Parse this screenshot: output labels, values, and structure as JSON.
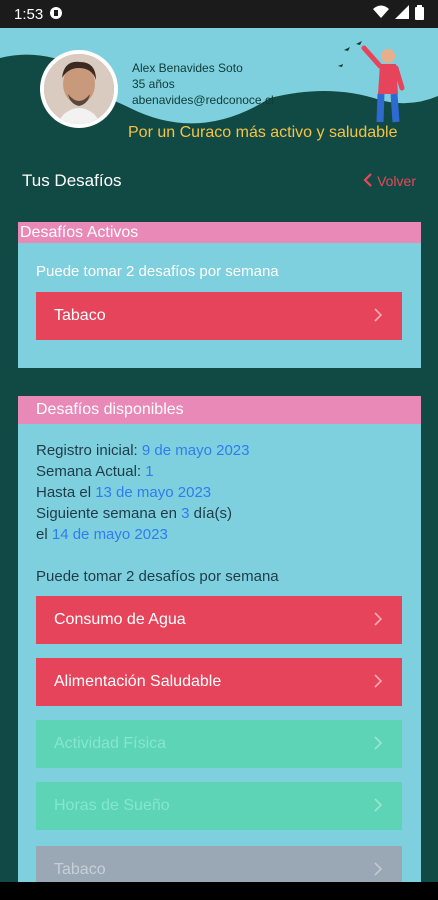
{
  "status": {
    "time": "1:53"
  },
  "profile": {
    "name": "Alex Benavides Soto",
    "age": "35 años",
    "email": "abenavides@redconoce.cl",
    "tagline": "Por un Curaco más activo y saludable"
  },
  "titlebar": {
    "title": "Tus Desafíos",
    "back": "Volver"
  },
  "active": {
    "header": "Desafíos Activos",
    "note": "Puede tomar 2 desafíos por semana",
    "items": [
      {
        "label": "Tabaco"
      }
    ]
  },
  "available": {
    "header": "Desafíos disponibles",
    "reg_label": "Registro inicial:",
    "reg_date": "9 de mayo 2023",
    "week_label": "Semana Actual:",
    "week_value": "1",
    "until_label": "Hasta el",
    "until_date": "13 de mayo 2023",
    "next_label": "Siguiente semana en",
    "next_days": "3",
    "next_unit": "día(s)",
    "on_label": "el",
    "on_date": "14 de mayo 2023",
    "note": "Puede tomar 2 desafíos por semana",
    "items": [
      {
        "label": "Consumo de Agua"
      },
      {
        "label": "Alimentación Saludable"
      },
      {
        "label": "Actividad Física"
      },
      {
        "label": "Horas de Sueño"
      },
      {
        "label": "Tabaco"
      }
    ]
  },
  "colors": {
    "accent_red": "#e6445b",
    "header_pink": "#e989b8",
    "panel_cyan": "#7fd0de",
    "tagline_yellow": "#f6c343",
    "date_blue": "#2f7cf0"
  }
}
